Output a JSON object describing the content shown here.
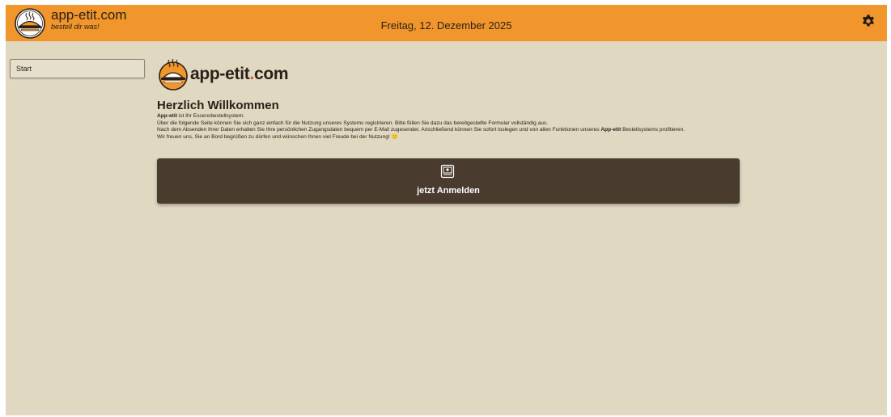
{
  "header": {
    "brand_name": "app-etit.com",
    "brand_slogan": "bestell dir was!",
    "date": "Freitag, 12. Dezember 2025",
    "settings_icon": "gear-icon"
  },
  "sidebar": {
    "items": [
      {
        "label": "Start"
      }
    ]
  },
  "main": {
    "logo": {
      "text_a": "app-etit",
      "text_dot": ".",
      "text_b": "com"
    },
    "title": "Herzlich Willkommen",
    "intro": {
      "line1_bold": "App-etit",
      "line1_rest": " ist Ihr Essensbestellsystem.",
      "line2": "Über die folgende Seite können Sie sich ganz einfach für die Nutzung unseres Systems registrieren. Bitte füllen Sie dazu das bereitgestellte Formular vollständig aus.",
      "line3_a": "Nach dem Absenden Ihrer Daten erhalten Sie Ihre persönlichen Zugangsdaten bequem per E-Mail zugesendet. Anschließend können Sie sofort loslegen und von allen Funktionen unseres ",
      "line3_bold": "App-etit",
      "line3_b": " Bestellsystems profitieren.",
      "line4": "Wir freuen uns, Sie an Bord begrüßen zu dürfen und wünschen Ihnen viel Freude bei der Nutzung! 🙂"
    },
    "register_button": {
      "label": "jetzt Anmelden",
      "icon": "registration-form-icon"
    }
  },
  "colors": {
    "header_bg": "#f0962c",
    "page_bg": "#e1d8c2",
    "button_bg": "#4a3b2f",
    "logo_dot": "#e0582a"
  }
}
